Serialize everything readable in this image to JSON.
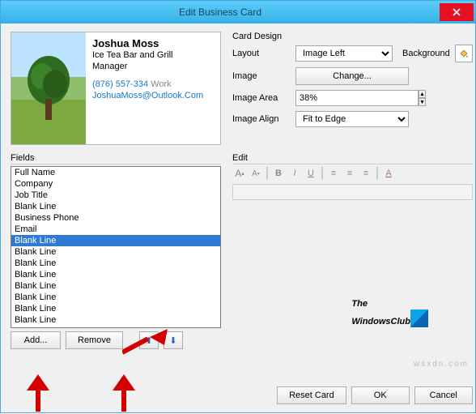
{
  "window": {
    "title": "Edit Business Card"
  },
  "preview": {
    "name": "Joshua Moss",
    "company": "Ice Tea Bar and Grill",
    "title": "Manager",
    "phone": "(876) 557-334",
    "phone_label": "Work",
    "email": "JoshuaMoss@Outlook.Com"
  },
  "design": {
    "header": "Card Design",
    "layout_label": "Layout",
    "layout_value": "Image Left",
    "background_label": "Background",
    "image_label": "Image",
    "change_label": "Change...",
    "area_label": "Image Area",
    "area_value": "38%",
    "align_label": "Image Align",
    "align_value": "Fit to Edge"
  },
  "fields": {
    "header": "Fields",
    "items": [
      "Full Name",
      "Company",
      "Job Title",
      "  Blank Line",
      "Business Phone",
      "Email",
      "  Blank Line",
      "  Blank Line",
      "  Blank Line",
      "  Blank Line",
      "  Blank Line",
      "  Blank Line",
      "  Blank Line",
      "  Blank Line"
    ],
    "selected_index": 6,
    "add_label": "Add...",
    "remove_label": "Remove"
  },
  "edit": {
    "header": "Edit"
  },
  "footer": {
    "reset_label": "Reset Card",
    "ok_label": "OK",
    "cancel_label": "Cancel"
  },
  "branding": {
    "line1": "The",
    "line2": "WindowsClub"
  },
  "watermark": "wsxdn.com"
}
